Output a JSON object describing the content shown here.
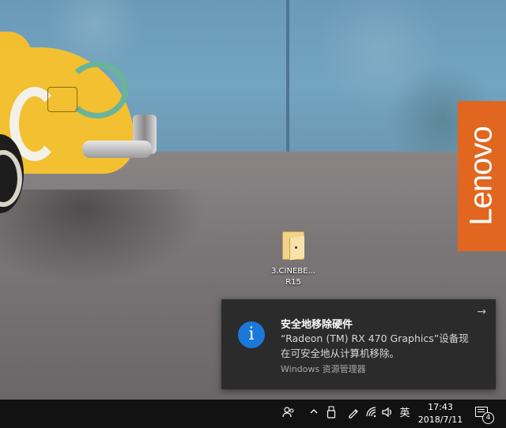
{
  "wallpaper": {
    "brand_text": "Lenovo"
  },
  "desktop": {
    "icons": [
      {
        "label": "3.CINEBE... R15"
      }
    ]
  },
  "toast": {
    "title": "安全地移除硬件",
    "body": "“Radeon (TM) RX 470 Graphics”设备现在可安全地从计算机移除。",
    "source": "Windows 资源管理器",
    "icon": "info-icon",
    "action_icon": "arrow-right-icon",
    "accent_color": "#1a78d8"
  },
  "taskbar": {
    "tray": {
      "people_icon": "people-icon",
      "overflow_icon": "chevron-up-icon",
      "usb_icon": "usb-drive-icon",
      "pen_icon": "pen-icon",
      "network_icon": "wifi-icon",
      "volume_icon": "speaker-icon",
      "ime_label": "英"
    },
    "clock": {
      "time": "17:43",
      "date": "2018/7/11"
    },
    "notifications": {
      "count": "4"
    }
  }
}
